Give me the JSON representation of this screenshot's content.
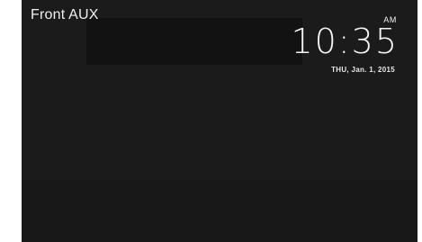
{
  "header": {
    "source": "Front AUX"
  },
  "clock": {
    "ampm": "AM",
    "time": "10:35",
    "date": "THU, Jan. 1, 2015"
  },
  "colors": {
    "screen_background": "#1b1b1b",
    "text": "#f0f0f0"
  }
}
